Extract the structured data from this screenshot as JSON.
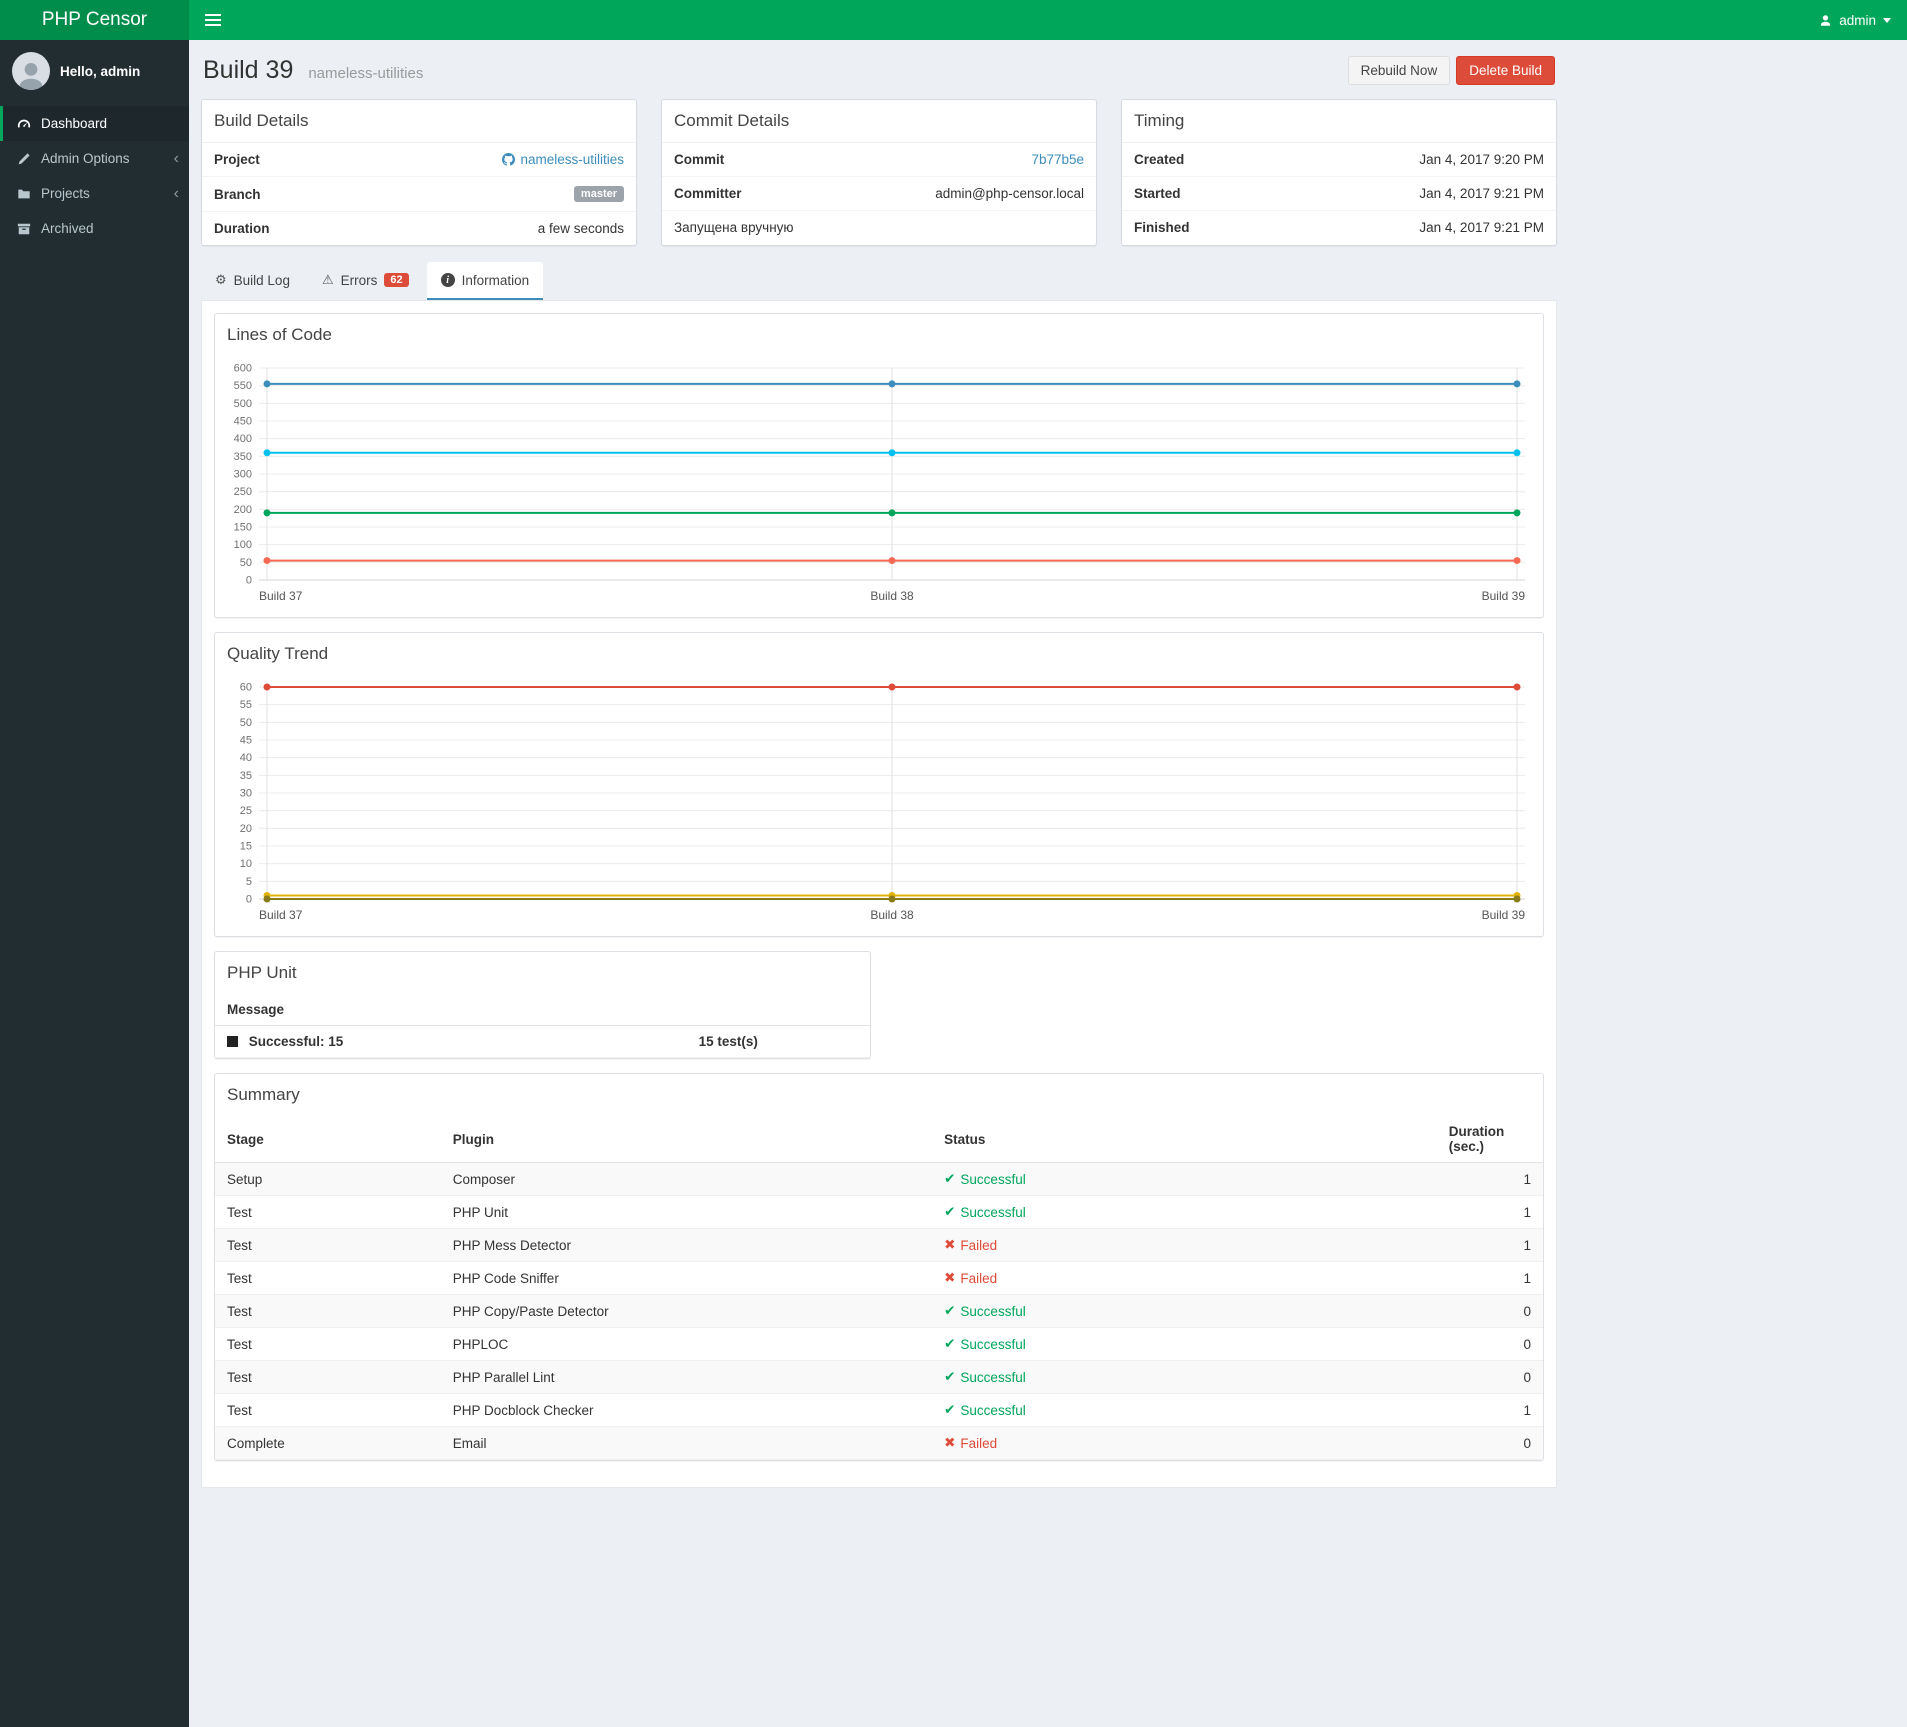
{
  "navbar": {
    "brand": "PHP Censor",
    "user": "admin"
  },
  "sidebar": {
    "greeting": "Hello, admin",
    "items": [
      {
        "label": "Dashboard"
      },
      {
        "label": "Admin Options"
      },
      {
        "label": "Projects"
      },
      {
        "label": "Archived"
      }
    ]
  },
  "page": {
    "title": "Build 39",
    "subtitle": "nameless-utilities",
    "rebuild_button": "Rebuild Now",
    "delete_button": "Delete Build"
  },
  "build_details": {
    "title": "Build Details",
    "project_label": "Project",
    "project_value": "nameless-utilities",
    "branch_label": "Branch",
    "branch_value": "master",
    "duration_label": "Duration",
    "duration_value": "a few seconds"
  },
  "commit_details": {
    "title": "Commit Details",
    "commit_label": "Commit",
    "commit_value": "7b77b5e",
    "committer_label": "Committer",
    "committer_value": "admin@php-censor.local",
    "note": "Запущена вручную"
  },
  "timing": {
    "title": "Timing",
    "created_label": "Created",
    "created_value": "Jan 4, 2017 9:20 PM",
    "started_label": "Started",
    "started_value": "Jan 4, 2017 9:21 PM",
    "finished_label": "Finished",
    "finished_value": "Jan 4, 2017 9:21 PM"
  },
  "tabs": {
    "build_log": "Build Log",
    "errors": "Errors",
    "errors_badge": "62",
    "information": "Information"
  },
  "chart_data": [
    {
      "type": "line",
      "title": "Lines of Code",
      "categories": [
        "Build 37",
        "Build 38",
        "Build 39"
      ],
      "series": [
        {
          "name": "line-blue",
          "color": "#3c8dbc",
          "values": [
            555,
            555,
            555
          ]
        },
        {
          "name": "line-cyan",
          "color": "#00c0ef",
          "values": [
            360,
            360,
            360
          ]
        },
        {
          "name": "line-green",
          "color": "#00a65a",
          "values": [
            190,
            190,
            190
          ]
        },
        {
          "name": "line-red",
          "color": "#f56954",
          "values": [
            55,
            55,
            55
          ]
        }
      ],
      "ylim": [
        0,
        600
      ],
      "ytick": 50,
      "legend": "none",
      "grid": true
    },
    {
      "type": "line",
      "title": "Quality Trend",
      "categories": [
        "Build 37",
        "Build 38",
        "Build 39"
      ],
      "series": [
        {
          "name": "line-red",
          "color": "#dd4b39",
          "values": [
            60,
            60,
            60
          ]
        },
        {
          "name": "line-yellow",
          "color": "#e0b307",
          "values": [
            1,
            1,
            1
          ]
        },
        {
          "name": "line-olive",
          "color": "#8a7a1e",
          "values": [
            0,
            0,
            0
          ]
        }
      ],
      "ylim": [
        0,
        60
      ],
      "ytick": 5,
      "legend": "none",
      "grid": true
    }
  ],
  "php_unit": {
    "title": "PHP Unit",
    "message_header": "Message",
    "status": "Successful: 15",
    "tests": "15 test(s)"
  },
  "summary": {
    "title": "Summary",
    "headers": [
      "Stage",
      "Plugin",
      "Status",
      "Duration (sec.)"
    ],
    "rows": [
      {
        "stage": "Setup",
        "plugin": "Composer",
        "status": "Successful",
        "ok": true,
        "duration": "1"
      },
      {
        "stage": "Test",
        "plugin": "PHP Unit",
        "status": "Successful",
        "ok": true,
        "duration": "1"
      },
      {
        "stage": "Test",
        "plugin": "PHP Mess Detector",
        "status": "Failed",
        "ok": false,
        "duration": "1"
      },
      {
        "stage": "Test",
        "plugin": "PHP Code Sniffer",
        "status": "Failed",
        "ok": false,
        "duration": "1"
      },
      {
        "stage": "Test",
        "plugin": "PHP Copy/Paste Detector",
        "status": "Successful",
        "ok": true,
        "duration": "0"
      },
      {
        "stage": "Test",
        "plugin": "PHPLOC",
        "status": "Successful",
        "ok": true,
        "duration": "0"
      },
      {
        "stage": "Test",
        "plugin": "PHP Parallel Lint",
        "status": "Successful",
        "ok": true,
        "duration": "0"
      },
      {
        "stage": "Test",
        "plugin": "PHP Docblock Checker",
        "status": "Successful",
        "ok": true,
        "duration": "1"
      },
      {
        "stage": "Complete",
        "plugin": "Email",
        "status": "Failed",
        "ok": false,
        "duration": "0"
      }
    ]
  },
  "icons": {
    "success_mark": "✔",
    "fail_mark": "✖",
    "gear": "⚙",
    "warning": "⚠",
    "info": "i",
    "chevron_left": "‹"
  },
  "colors": {
    "accent_green": "#00a65a",
    "danger_red": "#dd4b39",
    "link_blue": "#3c8dbc"
  }
}
